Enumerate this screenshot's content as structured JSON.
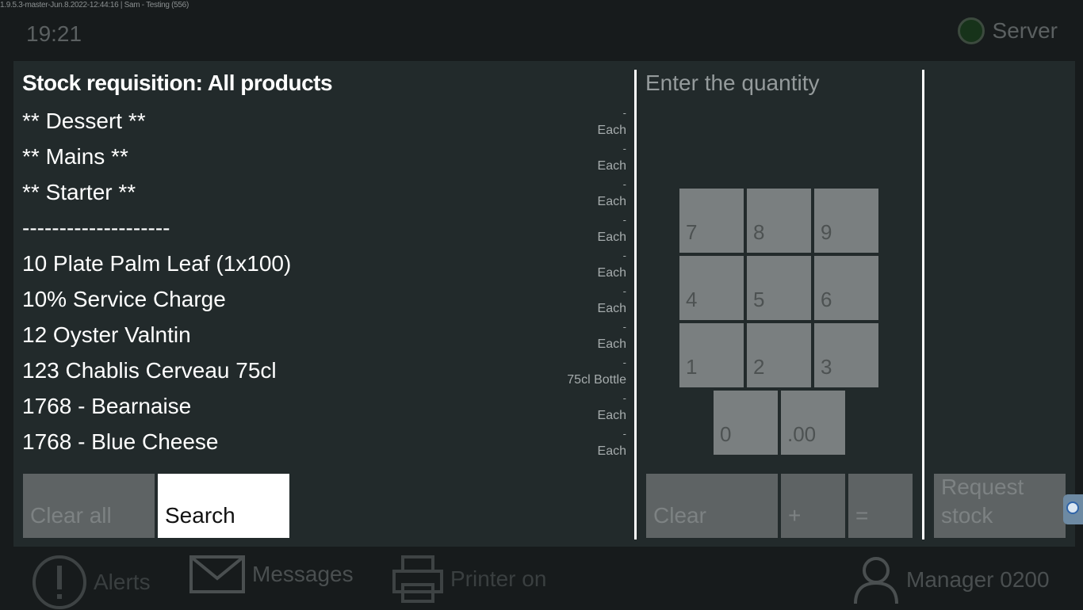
{
  "status_bar": {
    "version": "1.9.5.3-master-Jun.8.2022-12:44:16 | Sam - Testing (556)",
    "time": "19:21",
    "server_label": "Server"
  },
  "dialog": {
    "title": "Stock requisition: All products",
    "items": [
      {
        "name": "** Dessert **",
        "qty": "-",
        "unit": "Each"
      },
      {
        "name": "** Mains **",
        "qty": "-",
        "unit": "Each"
      },
      {
        "name": "** Starter **",
        "qty": "-",
        "unit": "Each"
      },
      {
        "name": "--------------------",
        "qty": "-",
        "unit": "Each"
      },
      {
        "name": "10 Plate Palm Leaf (1x100)",
        "qty": "-",
        "unit": "Each"
      },
      {
        "name": "10% Service Charge",
        "qty": "-",
        "unit": "Each"
      },
      {
        "name": "12 Oyster Valntin",
        "qty": "-",
        "unit": "Each"
      },
      {
        "name": "123 Chablis Cerveau 75cl",
        "qty": "-",
        "unit": "75cl Bottle"
      },
      {
        "name": "1768 - Bearnaise",
        "qty": "-",
        "unit": "Each"
      },
      {
        "name": "1768 - Blue Cheese",
        "qty": "-",
        "unit": "Each"
      }
    ],
    "clear_all_label": "Clear all",
    "search_label": "Search",
    "quantity_prompt": "Enter the quantity",
    "keypad": {
      "k7": "7",
      "k8": "8",
      "k9": "9",
      "k4": "4",
      "k5": "5",
      "k6": "6",
      "k1": "1",
      "k2": "2",
      "k3": "3",
      "k0": "0",
      "k00": ".00"
    },
    "clear_label": "Clear",
    "plus_label": "+",
    "equals_label": "=",
    "request_line1": "Request",
    "request_line2": "stock"
  },
  "footer": {
    "alerts_label": "Alerts",
    "messages_label": "Messages",
    "printer_label": "Printer on",
    "user_label": "Manager 0200"
  }
}
